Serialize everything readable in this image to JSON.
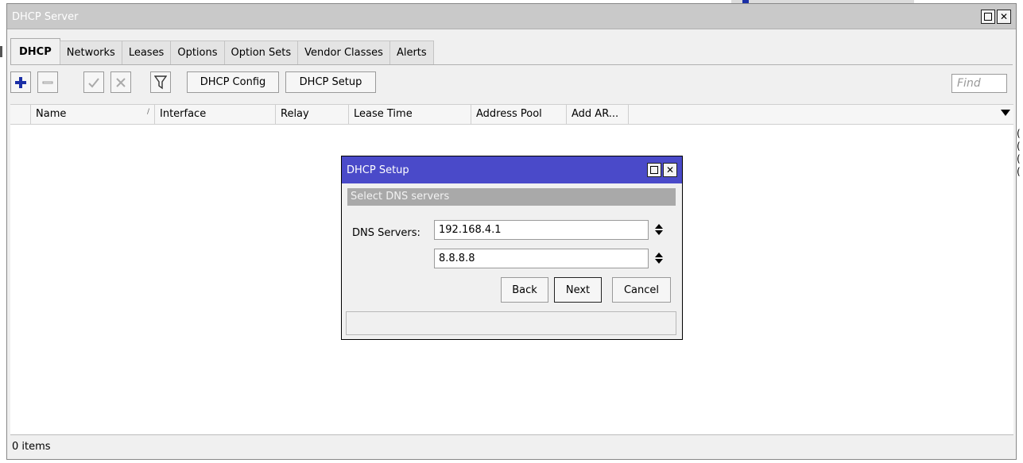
{
  "window": {
    "title": "DHCP Server"
  },
  "tabs": [
    {
      "label": "DHCP",
      "active": true
    },
    {
      "label": "Networks",
      "active": false
    },
    {
      "label": "Leases",
      "active": false
    },
    {
      "label": "Options",
      "active": false
    },
    {
      "label": "Option Sets",
      "active": false
    },
    {
      "label": "Vendor Classes",
      "active": false
    },
    {
      "label": "Alerts",
      "active": false
    }
  ],
  "toolbar": {
    "dhcp_config_label": "DHCP Config",
    "dhcp_setup_label": "DHCP Setup",
    "find_placeholder": "Find"
  },
  "table": {
    "columns": [
      "Name",
      "Interface",
      "Relay",
      "Lease Time",
      "Address Pool",
      "Add AR..."
    ],
    "sort_indicator": "/",
    "rows": []
  },
  "status": {
    "items_count": "0 items"
  },
  "dialog": {
    "title": "DHCP Setup",
    "section": "Select DNS servers",
    "dns_label": "DNS Servers:",
    "dns_servers": [
      "192.168.4.1",
      "8.8.8.8"
    ],
    "back_label": "Back",
    "next_label": "Next",
    "cancel_label": "Cancel"
  },
  "colors": {
    "dialog_title_bg": "#4a4ac9",
    "window_title_bg": "#c9c9c9",
    "add_icon": "#1b2fa6"
  }
}
